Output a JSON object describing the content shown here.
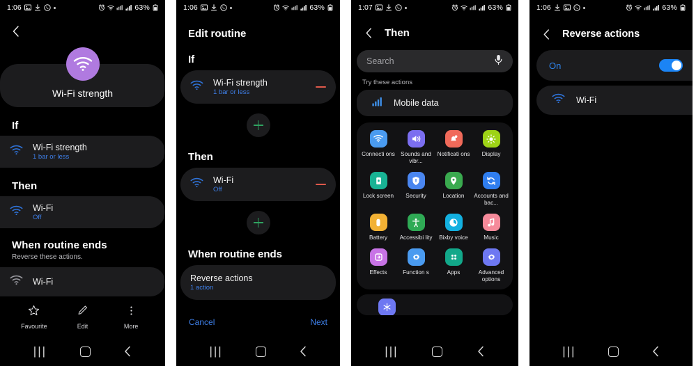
{
  "panel1": {
    "status": {
      "time": "1:06",
      "battery": "63%",
      "icons": [
        "image-icon",
        "download-icon",
        "whatsapp-icon",
        "dot-icon",
        "alarm-icon",
        "wifi-status-icon",
        "signal-sim-icon",
        "signal-bars-icon",
        "battery-icon"
      ]
    },
    "back_label": "Back",
    "hero": {
      "name": "Wi-Fi strength",
      "circle_color": "#b07ae0"
    },
    "if_heading": "If",
    "if_item": {
      "title": "Wi-Fi strength",
      "subtitle": "1 bar or less"
    },
    "then_heading": "Then",
    "then_item": {
      "title": "Wi-Fi",
      "subtitle": "Off"
    },
    "when_ends_heading": "When routine ends",
    "when_ends_sub": "Reverse these actions.",
    "when_ends_item": {
      "title": "Wi-Fi"
    },
    "bottom_bar": [
      {
        "label": "Favourite",
        "icon": "star-icon"
      },
      {
        "label": "Edit",
        "icon": "pencil-icon"
      },
      {
        "label": "More",
        "icon": "more-vertical-icon"
      }
    ]
  },
  "panel2": {
    "status": {
      "time": "1:06",
      "battery": "63%"
    },
    "title": "Edit routine",
    "if_heading": "If",
    "if_item": {
      "title": "Wi-Fi strength",
      "subtitle": "1 bar or less"
    },
    "then_heading": "Then",
    "then_item": {
      "title": "Wi-Fi",
      "subtitle": "Off"
    },
    "when_ends_heading": "When routine ends",
    "reverse": {
      "title": "Reverse actions",
      "subtitle": "1 action"
    },
    "cancel_label": "Cancel",
    "next_label": "Next"
  },
  "panel3": {
    "status": {
      "time": "1:07",
      "battery": "63%"
    },
    "title": "Then",
    "search": {
      "placeholder": "Search",
      "mic_icon": "microphone-icon"
    },
    "try_label": "Try these actions",
    "suggestion": {
      "label": "Mobile data",
      "icon": "signal-bars-icon"
    },
    "grid": [
      {
        "label": "Connecti\nons",
        "color": "#4a9bf0",
        "icon": "wifi-icon"
      },
      {
        "label": "Sounds\nand vibr...",
        "color": "#7b6ef0",
        "icon": "speaker-icon"
      },
      {
        "label": "Notificati\nons",
        "color": "#f06a5a",
        "icon": "notification-icon"
      },
      {
        "label": "Display",
        "color": "#9ed316",
        "icon": "brightness-icon"
      },
      {
        "label": "Lock\nscreen",
        "color": "#18b394",
        "icon": "lock-icon"
      },
      {
        "label": "Security",
        "color": "#4a86f0",
        "icon": "shield-icon"
      },
      {
        "label": "Location",
        "color": "#3aaa4f",
        "icon": "pin-icon"
      },
      {
        "label": "Accounts\nand bac...",
        "color": "#2f7ef0",
        "icon": "sync-icon"
      },
      {
        "label": "Battery",
        "color": "#f2b134",
        "icon": "battery-icon"
      },
      {
        "label": "Accessibi\nlity",
        "color": "#2faa55",
        "icon": "accessibility-icon"
      },
      {
        "label": "Bixby\nvoice",
        "color": "#13b0e0",
        "icon": "bixby-icon"
      },
      {
        "label": "Music",
        "color": "#f58a9a",
        "icon": "music-note-icon"
      },
      {
        "label": "Effects",
        "color": "#c873e6",
        "icon": "effects-icon"
      },
      {
        "label": "Function\ns",
        "color": "#4a9bf0",
        "icon": "gear-icon"
      },
      {
        "label": "Apps",
        "color": "#12a88a",
        "icon": "grid-apps-icon"
      },
      {
        "label": "Advanced\noptions",
        "color": "#6e78f2",
        "icon": "gear-icon"
      }
    ],
    "partial_icon": {
      "color": "#6e78f2",
      "icon": "snowflake-icon"
    }
  },
  "panel4": {
    "status": {
      "time": "1:06",
      "battery": "63%"
    },
    "title": "Reverse actions",
    "toggle": {
      "label": "On",
      "state": "on",
      "accent": "#1b84f5"
    },
    "item": {
      "title": "Wi-Fi",
      "icon": "wifi-icon"
    }
  },
  "navbar": {
    "recents": "|||",
    "home_icon": "home-square-icon",
    "back_icon": "back-chevron-icon"
  }
}
